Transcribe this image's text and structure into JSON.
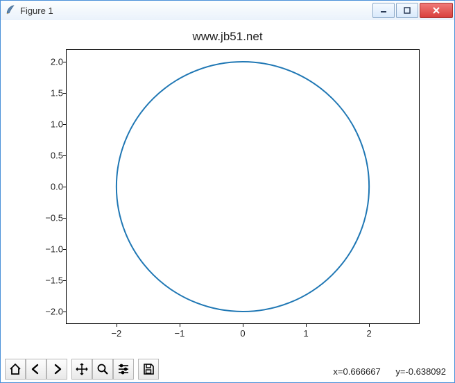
{
  "window": {
    "title": "Figure 1"
  },
  "toolbar": {
    "home": "Home",
    "back": "Back",
    "forward": "Forward",
    "pan": "Pan",
    "zoom": "Zoom",
    "subplots": "Configure subplots",
    "save": "Save"
  },
  "status": {
    "x_label": "x=0.666667",
    "y_label": "y=-0.638092"
  },
  "chart_data": {
    "type": "line",
    "title": "www.jb51.net",
    "xlabel": "",
    "ylabel": "",
    "xlim": [
      -2.8,
      2.8
    ],
    "ylim": [
      -2.2,
      2.2
    ],
    "xticks": [
      -2,
      -1,
      0,
      1,
      2
    ],
    "yticks": [
      -2.0,
      -1.5,
      -1.0,
      -0.5,
      0.0,
      0.5,
      1.0,
      1.5,
      2.0
    ],
    "xtick_labels": [
      "−2",
      "−1",
      "0",
      "1",
      "2"
    ],
    "ytick_labels": [
      "−2.0",
      "−1.5",
      "−1.0",
      "−0.5",
      "0.0",
      "0.5",
      "1.0",
      "1.5",
      "2.0"
    ],
    "series": [
      {
        "name": "circle",
        "kind": "parametric-circle",
        "cx": 0,
        "cy": 0,
        "r": 2,
        "color": "#1f77b4"
      }
    ]
  }
}
